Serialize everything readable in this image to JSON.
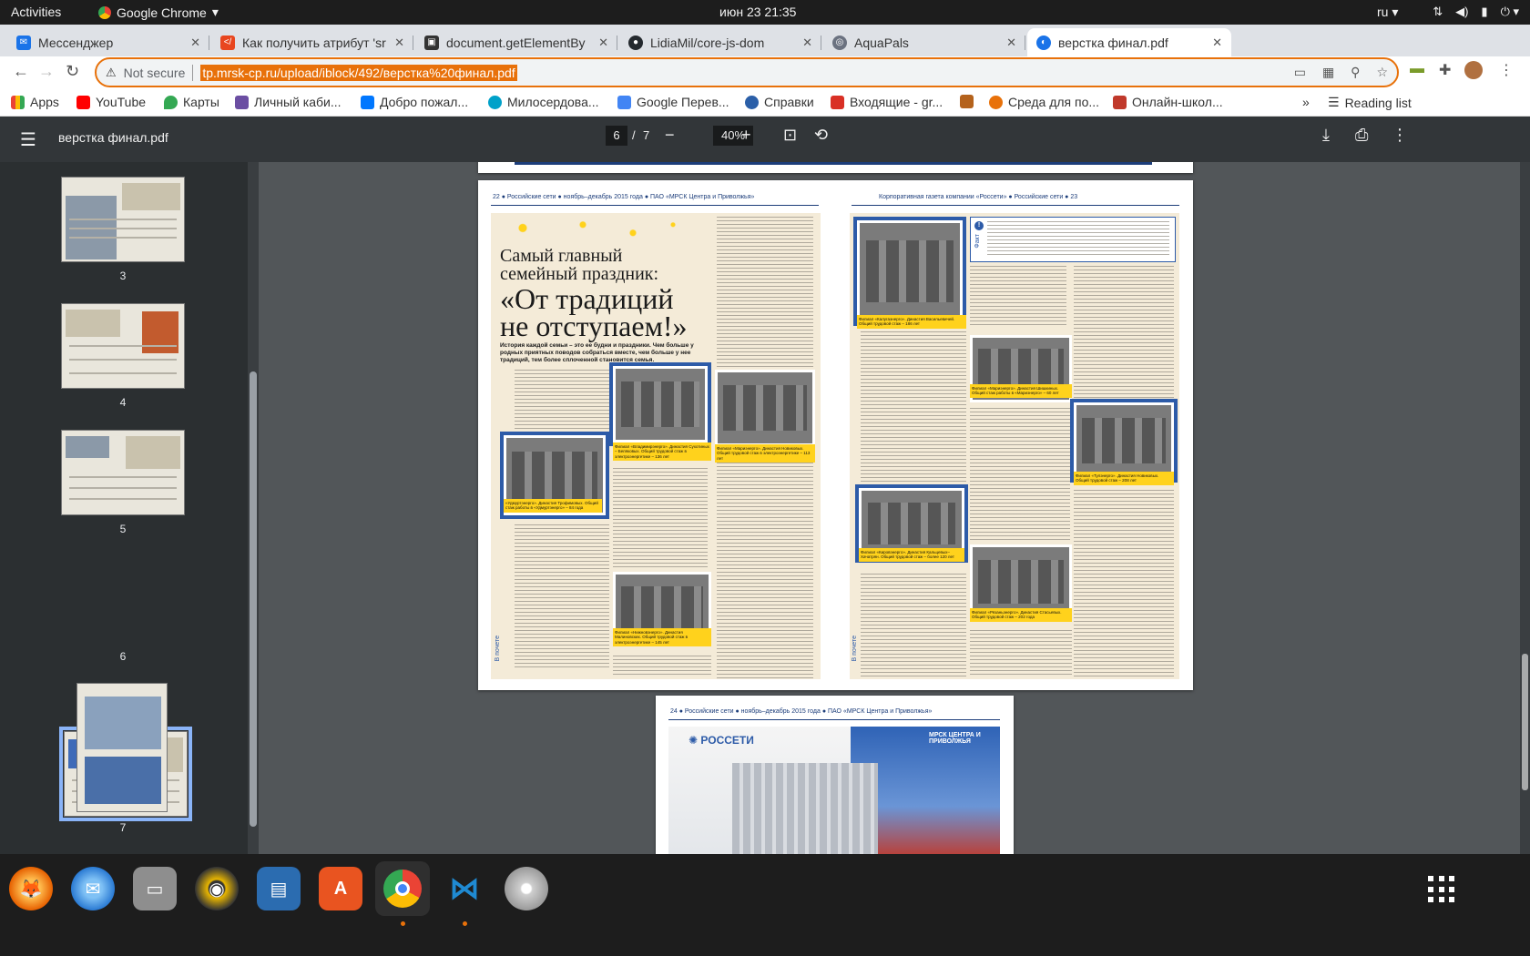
{
  "system": {
    "activities": "Activities",
    "app_name": "Google Chrome",
    "clock": "июн 23  21:35",
    "lang": "ru",
    "tray_icons": [
      "network-icon",
      "volume-icon",
      "battery-icon",
      "power-icon"
    ]
  },
  "tabs": [
    {
      "title": "Мессенджер",
      "favicon_color": "#1a73e8"
    },
    {
      "title": "Как получить атрибут 'sr",
      "favicon_color": "#e8461f"
    },
    {
      "title": "document.getElementBy",
      "favicon_color": "#333333"
    },
    {
      "title": "LidiaMil/core-js-dom",
      "favicon_color": "#24292e"
    },
    {
      "title": "AquaPals",
      "favicon_color": "#6b7280"
    },
    {
      "title": "верстка финал.pdf",
      "favicon_color": "#1a73e8",
      "active": true
    }
  ],
  "omnibox": {
    "security": "Not secure",
    "url": "tp.mrsk-cp.ru/upload/iblock/492/верстка%20финал.pdf"
  },
  "bookmarks": [
    {
      "label": "Apps",
      "color": "#4285f4"
    },
    {
      "label": "YouTube",
      "color": "#ff0000"
    },
    {
      "label": "Карты",
      "color": "#34a853"
    },
    {
      "label": "Личный каби...",
      "color": "#6b4ea2"
    },
    {
      "label": "Добро пожал...",
      "color": "#0077ff"
    },
    {
      "label": "Милосердова...",
      "color": "#00a1c9"
    },
    {
      "label": "Google Перев...",
      "color": "#4285f4"
    },
    {
      "label": "Справки",
      "color": "#2b5fa8"
    },
    {
      "label": "Входящие - gr...",
      "color": "#d93025"
    },
    {
      "label": "",
      "color": "#b4621c"
    },
    {
      "label": "Среда для по...",
      "color": "#e8710a"
    },
    {
      "label": "Онлайн-школ...",
      "color": "#c0392b"
    }
  ],
  "reading_list": "Reading list",
  "more_bookmarks": "»",
  "pdf": {
    "title": "верстка финал.pdf",
    "page_current": "6",
    "page_sep": "/",
    "page_total": "7",
    "zoom": "40%"
  },
  "thumbnails": [
    {
      "label": "3"
    },
    {
      "label": "4"
    },
    {
      "label": "5"
    },
    {
      "label": "6",
      "selected": true
    },
    {
      "label": "7"
    }
  ],
  "spread": {
    "left_running_head": "22  ●  Российские сети  ●  ноябрь–декабрь 2015 года  ●  ПАО «МРСК Центра и Приволжья»",
    "right_running_head": "Корпоративная газета компании «Россети»  ●  Российские сети  ●  23",
    "headline_line1": "Самый главный",
    "headline_line2": "семейный праздник:",
    "headline_line3": "«От традиций",
    "headline_line4": "не отступаем!»",
    "deck": "История каждой семьи – это ее будни и праздники. Чем больше у родных приятных поводов собраться вместе, чем больше у нее традиций, тем более сплоченной становится семья.",
    "side_label": "В почете",
    "fact_label": "Факт",
    "fact_mark": "!",
    "captions": [
      "Филиал «Владимирэнерго». Династия Сухотиных – Беляковых. Общий трудовой стаж в электроэнергетике – 136 лет",
      "«Удмуртэнерго». Династия Трофимовых. Общий стаж работы в «Удмуртэнерго» – 84 года",
      "Филиал «Мариэнерго». Династия Новиковых. Общий трудовой стаж в электроэнергетике – 113 лет",
      "Филиал «Нижновэнерго». Династия Малиновских. Общий трудовой стаж в электроэнергетике – 145 лет",
      "Филиал «Калугаэнерго». Династия Васильевичей. Общий трудовой стаж – 186 лет",
      "Филиал «Мариэнерго». Династия Шишкиных. Общий стаж работы в «Мариэнерго» – 60 лет",
      "Филиал «Тулэнерго». Династия Новиковых. Общий трудовой стаж – 208 лет",
      "Филиал «Кировэнерго». Династия Кальцевых–Хачатрян. Общий трудовой стаж – более 120 лет",
      "Филиал «Рязаньэнерго». Династия Стасьевых. Общий трудовой стаж – 202 года"
    ]
  },
  "next_page": {
    "running_head": "24  ●  Российские сети  ●  ноябрь–декабрь 2015 года  ●  ПАО «МРСК Центра и Приволжья»",
    "logo_left": "РОССЕТИ",
    "logo_right": "МРСК ЦЕНТРА И ПРИВОЛЖЬЯ"
  },
  "dock": [
    {
      "name": "firefox",
      "color": "#e66000"
    },
    {
      "name": "thunderbird",
      "color": "#2a7ad3"
    },
    {
      "name": "files",
      "color": "#8e8e8e"
    },
    {
      "name": "rhythmbox",
      "color": "#e9b600"
    },
    {
      "name": "writer",
      "color": "#2b6cb0"
    },
    {
      "name": "software",
      "color": "#e95420"
    },
    {
      "name": "chrome",
      "color": "#4285f4"
    },
    {
      "name": "vscode",
      "color": "#1f8ad2"
    },
    {
      "name": "disc",
      "color": "#cfcfcf"
    }
  ]
}
